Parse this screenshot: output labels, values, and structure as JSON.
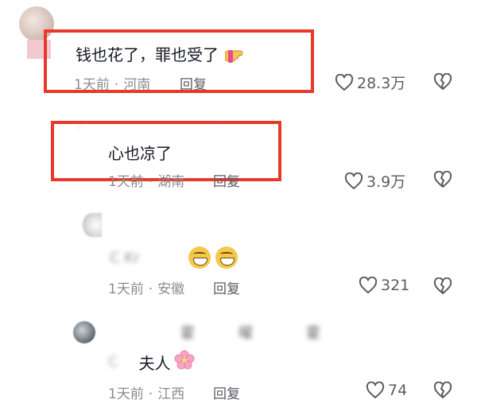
{
  "comments": [
    {
      "text": "钱也花了，罪也受了",
      "emoji": "point-right-hand",
      "time": "1天前",
      "location": "河南",
      "reply_label": "回复",
      "likes": "28.3万"
    },
    {
      "text": "心也凉了",
      "time": "1天前",
      "location": "湖南",
      "reply_label": "回复",
      "likes": "3.9万"
    },
    {
      "text_partial": "C Kr",
      "emoji": "grinning-face x2",
      "time": "1天前",
      "location": "安徽",
      "reply_label": "回复",
      "likes": "321"
    },
    {
      "username_partial": [
        "霍",
        "曜",
        "霍"
      ],
      "text_partial": "夫人",
      "emoji": "cherry-blossom",
      "time": "1天前",
      "location": "江西",
      "reply_label": "回复",
      "likes": "74"
    }
  ],
  "colors": {
    "highlight": "#e8392a",
    "text": "#161823",
    "meta": "#8a8b91",
    "icon": "#5b5c63"
  }
}
